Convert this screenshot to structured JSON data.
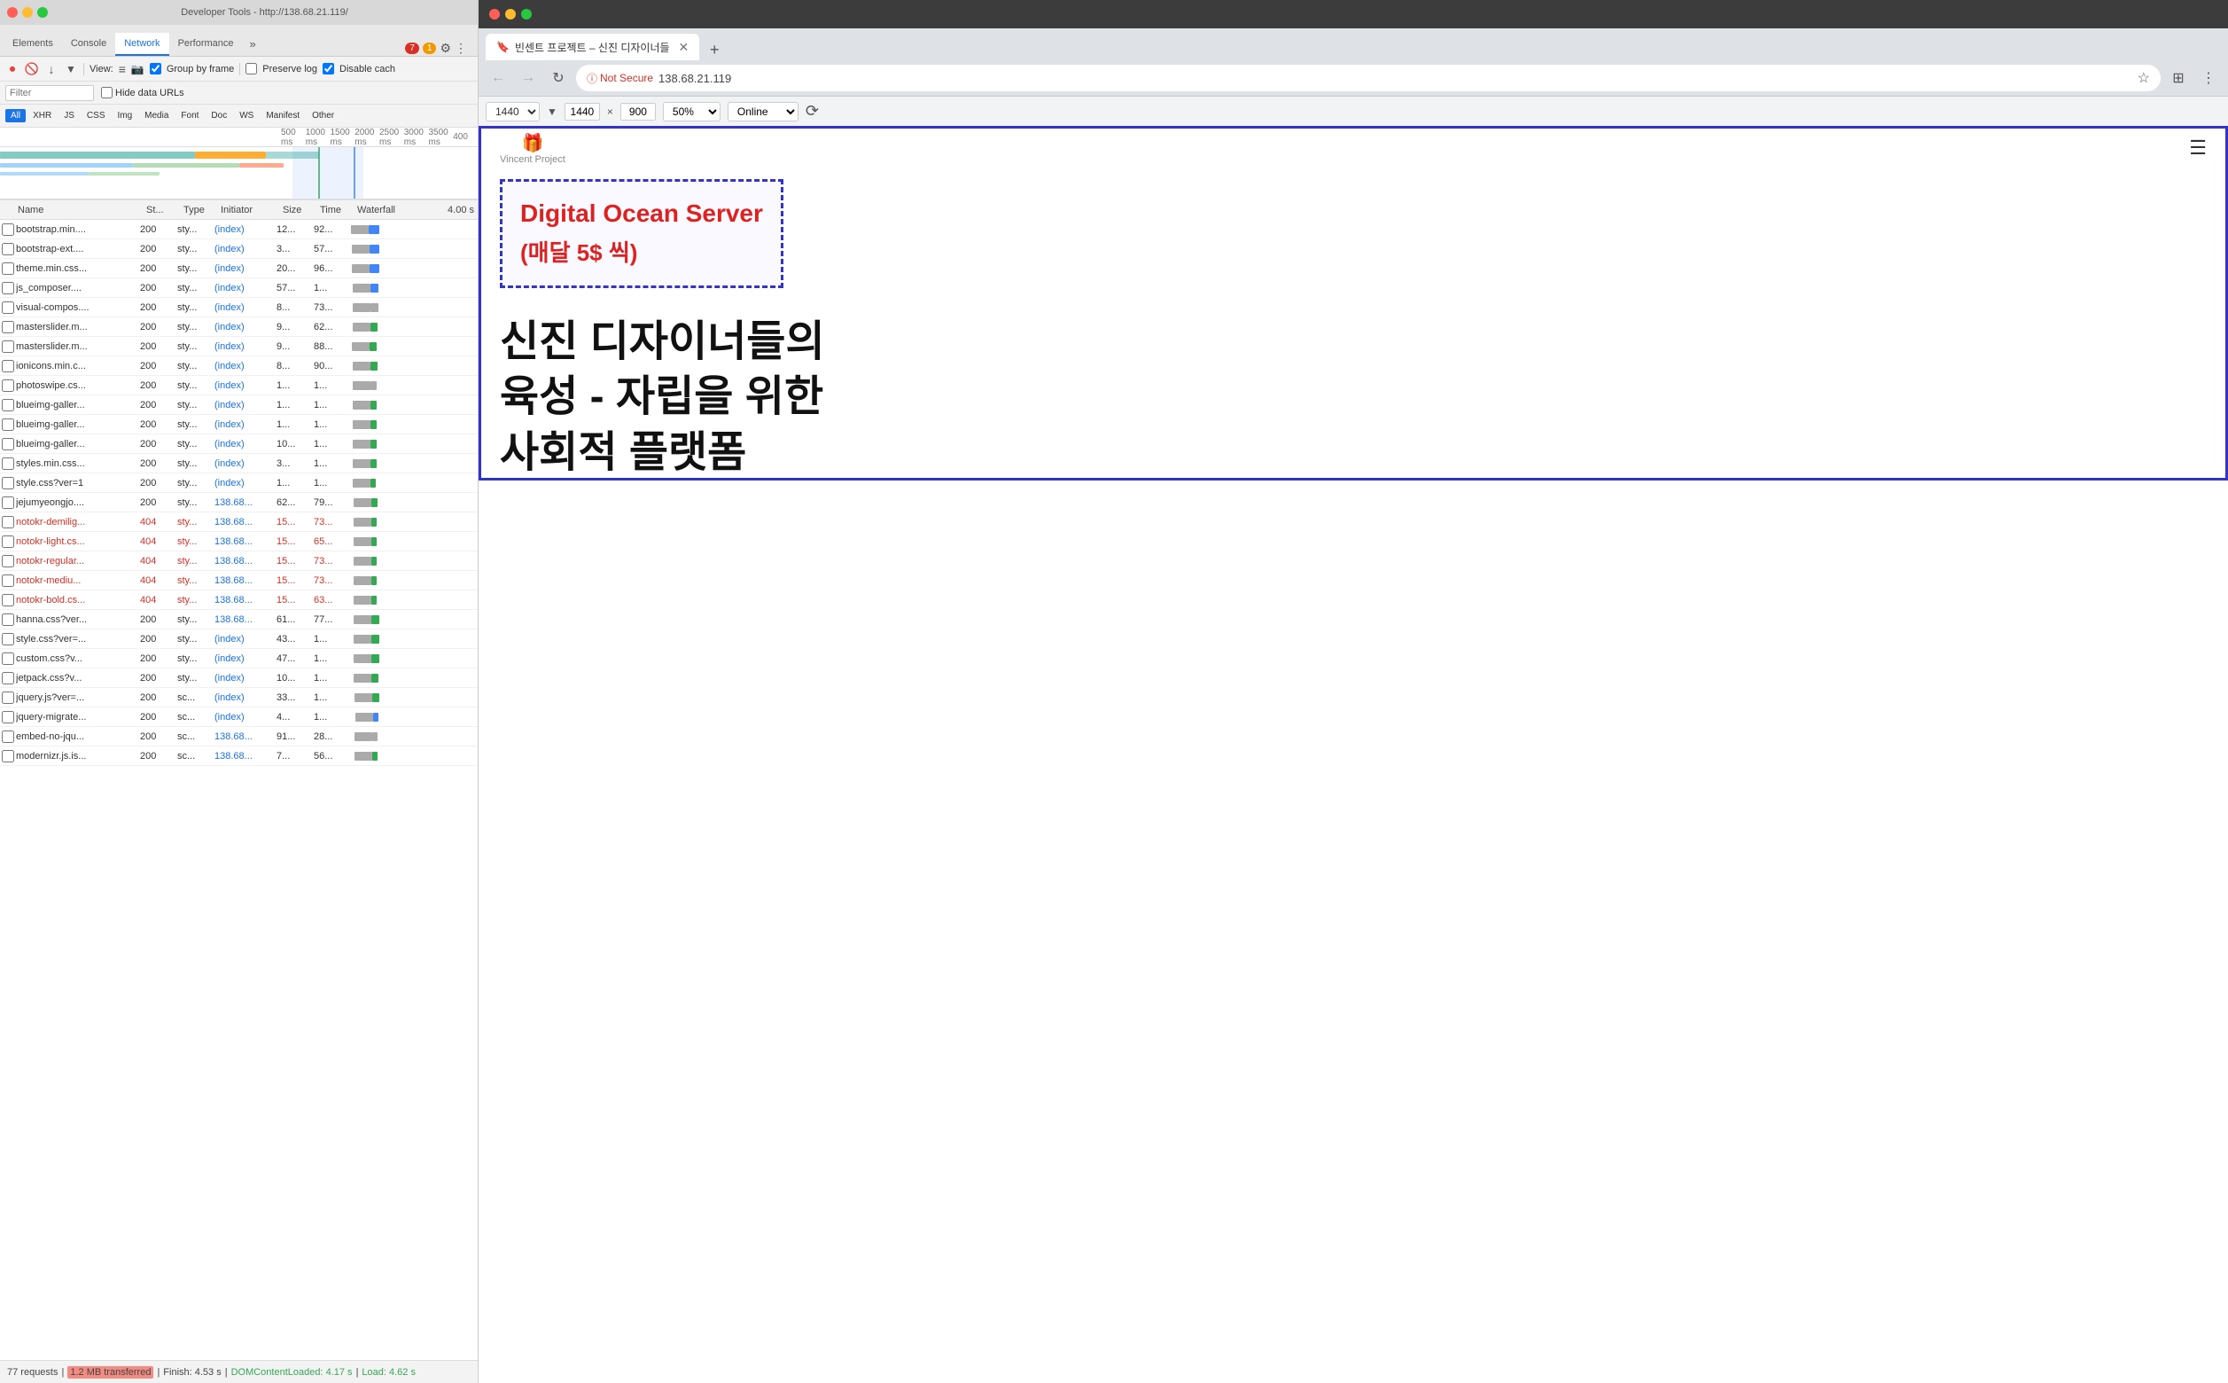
{
  "devtools": {
    "titlebar": "Developer Tools - http://138.68.21.119/",
    "tabs": [
      {
        "label": "Elements",
        "active": false
      },
      {
        "label": "Console",
        "active": false
      },
      {
        "label": "Network",
        "active": true
      },
      {
        "label": "Performance",
        "active": false
      }
    ],
    "tab_more": "»",
    "errors": "7",
    "warnings": "1",
    "toolbar": {
      "record_label": "●",
      "clear_label": "🚫",
      "fetch_label": "↓",
      "filter_label": "▼",
      "view_label": "View:",
      "group_by_frame": "Group by frame",
      "preserve_log": "Preserve log",
      "disable_cache": "Disable cach"
    },
    "filter": {
      "placeholder": "Filter",
      "hide_data_urls": "Hide data URLs"
    },
    "type_filters": [
      "All",
      "XHR",
      "JS",
      "CSS",
      "Img",
      "Media",
      "Font",
      "Doc",
      "WS",
      "Manifest",
      "Other"
    ],
    "active_type": "All",
    "ruler": {
      "marks": [
        "500 ms",
        "1000 ms",
        "1500 ms",
        "2000 ms",
        "2500 ms",
        "3000 ms",
        "3500 ms",
        "400"
      ]
    },
    "table_headers": {
      "name": "Name",
      "status": "St...",
      "type": "Type",
      "initiator": "Initiator",
      "size": "Size",
      "time": "Time",
      "waterfall": "Waterfall",
      "waterfall_right": "4.00 s"
    },
    "rows": [
      {
        "name": "bootstrap.min....",
        "status": "200",
        "type": "sty...",
        "initiator": "(index)",
        "size": "12...",
        "time": "92...",
        "wf_start": 0,
        "wf_len": 60,
        "color": "blue",
        "error": false
      },
      {
        "name": "bootstrap-ext....",
        "status": "200",
        "type": "sty...",
        "initiator": "(index)",
        "size": "3...",
        "time": "57...",
        "wf_start": 5,
        "wf_len": 55,
        "color": "blue",
        "error": false
      },
      {
        "name": "theme.min.css...",
        "status": "200",
        "type": "sty...",
        "initiator": "(index)",
        "size": "20...",
        "time": "96...",
        "wf_start": 3,
        "wf_len": 58,
        "color": "blue",
        "error": false
      },
      {
        "name": "js_composer....",
        "status": "200",
        "type": "sty...",
        "initiator": "(index)",
        "size": "57...",
        "time": "1...",
        "wf_start": 8,
        "wf_len": 50,
        "color": "blue",
        "error": false
      },
      {
        "name": "visual-compos....",
        "status": "200",
        "type": "sty...",
        "initiator": "(index)",
        "size": "8...",
        "time": "73...",
        "wf_start": 10,
        "wf_len": 45,
        "color": "gray",
        "error": false
      },
      {
        "name": "masterslider.m...",
        "status": "200",
        "type": "sty...",
        "initiator": "(index)",
        "size": "9...",
        "time": "62...",
        "wf_start": 8,
        "wf_len": 40,
        "color": "green",
        "error": false
      },
      {
        "name": "masterslider.m...",
        "status": "200",
        "type": "sty...",
        "initiator": "(index)",
        "size": "9...",
        "time": "88...",
        "wf_start": 6,
        "wf_len": 42,
        "color": "green",
        "error": false
      },
      {
        "name": "ionicons.min.c...",
        "status": "200",
        "type": "sty...",
        "initiator": "(index)",
        "size": "8...",
        "time": "90...",
        "wf_start": 7,
        "wf_len": 44,
        "color": "green",
        "error": false
      },
      {
        "name": "photoswipe.cs...",
        "status": "200",
        "type": "sty...",
        "initiator": "(index)",
        "size": "1...",
        "time": "1...",
        "wf_start": 9,
        "wf_len": 38,
        "color": "gray",
        "error": false
      },
      {
        "name": "blueimg-galler...",
        "status": "200",
        "type": "sty...",
        "initiator": "(index)",
        "size": "1...",
        "time": "1...",
        "wf_start": 9,
        "wf_len": 38,
        "color": "green",
        "error": false
      },
      {
        "name": "blueimg-galler...",
        "status": "200",
        "type": "sty...",
        "initiator": "(index)",
        "size": "1...",
        "time": "1...",
        "wf_start": 9,
        "wf_len": 38,
        "color": "green",
        "error": false
      },
      {
        "name": "blueimg-galler...",
        "status": "200",
        "type": "sty...",
        "initiator": "(index)",
        "size": "10...",
        "time": "1...",
        "wf_start": 9,
        "wf_len": 38,
        "color": "green",
        "error": false
      },
      {
        "name": "styles.min.css...",
        "status": "200",
        "type": "sty...",
        "initiator": "(index)",
        "size": "3...",
        "time": "1...",
        "wf_start": 8,
        "wf_len": 36,
        "color": "green",
        "error": false
      },
      {
        "name": "style.css?ver=1",
        "status": "200",
        "type": "sty...",
        "initiator": "(index)",
        "size": "1...",
        "time": "1...",
        "wf_start": 8,
        "wf_len": 34,
        "color": "green",
        "error": false
      },
      {
        "name": "jejumyeongjo....",
        "status": "200",
        "type": "sty...",
        "initiator": "138.68...",
        "size": "62...",
        "time": "79...",
        "wf_start": 12,
        "wf_len": 40,
        "color": "green",
        "error": false
      },
      {
        "name": "notokr-demilig...",
        "status": "404",
        "type": "sty...",
        "initiator": "138.68...",
        "size": "15...",
        "time": "73...",
        "wf_start": 11,
        "wf_len": 30,
        "color": "green",
        "error": true
      },
      {
        "name": "notokr-light.cs...",
        "status": "404",
        "type": "sty...",
        "initiator": "138.68...",
        "size": "15...",
        "time": "65...",
        "wf_start": 11,
        "wf_len": 28,
        "color": "green",
        "error": true
      },
      {
        "name": "notokr-regular...",
        "status": "404",
        "type": "sty...",
        "initiator": "138.68...",
        "size": "15...",
        "time": "73...",
        "wf_start": 11,
        "wf_len": 30,
        "color": "green",
        "error": true
      },
      {
        "name": "notokr-mediu...",
        "status": "404",
        "type": "sty...",
        "initiator": "138.68...",
        "size": "15...",
        "time": "73...",
        "wf_start": 11,
        "wf_len": 30,
        "color": "green",
        "error": true
      },
      {
        "name": "notokr-bold.cs...",
        "status": "404",
        "type": "sty...",
        "initiator": "138.68...",
        "size": "15...",
        "time": "63...",
        "wf_start": 11,
        "wf_len": 28,
        "color": "green",
        "error": true
      },
      {
        "name": "hanna.css?ver...",
        "status": "200",
        "type": "sty...",
        "initiator": "138.68...",
        "size": "61...",
        "time": "77...",
        "wf_start": 15,
        "wf_len": 45,
        "color": "green",
        "error": false
      },
      {
        "name": "style.css?ver=...",
        "status": "200",
        "type": "sty...",
        "initiator": "(index)",
        "size": "43...",
        "time": "1...",
        "wf_start": 14,
        "wf_len": 44,
        "color": "green",
        "error": false
      },
      {
        "name": "custom.css?v...",
        "status": "200",
        "type": "sty...",
        "initiator": "(index)",
        "size": "47...",
        "time": "1...",
        "wf_start": 14,
        "wf_len": 44,
        "color": "green",
        "error": false
      },
      {
        "name": "jetpack.css?v...",
        "status": "200",
        "type": "sty...",
        "initiator": "(index)",
        "size": "10...",
        "time": "1...",
        "wf_start": 14,
        "wf_len": 42,
        "color": "green",
        "error": false
      },
      {
        "name": "jquery.js?ver=...",
        "status": "200",
        "type": "sc...",
        "initiator": "(index)",
        "size": "33...",
        "time": "1...",
        "wf_start": 16,
        "wf_len": 46,
        "color": "green",
        "error": false
      },
      {
        "name": "jquery-migrate...",
        "status": "200",
        "type": "sc...",
        "initiator": "(index)",
        "size": "4...",
        "time": "1...",
        "wf_start": 20,
        "wf_len": 30,
        "color": "blue",
        "error": false
      },
      {
        "name": "embed-no-jqu...",
        "status": "200",
        "type": "sc...",
        "initiator": "138.68...",
        "size": "91...",
        "time": "28...",
        "wf_start": 18,
        "wf_len": 30,
        "color": "gray",
        "error": false
      },
      {
        "name": "modernizr.js.is...",
        "status": "200",
        "type": "sc...",
        "initiator": "138.68...",
        "size": "7...",
        "time": "56...",
        "wf_start": 18,
        "wf_len": 28,
        "color": "green",
        "error": false
      }
    ],
    "statusbar": {
      "requests": "77 requests",
      "transferred": "1.2 MB transferred",
      "finish": "Finish: 4.53 s",
      "dom_loaded": "DOMContentLoaded: 4.17 s",
      "load": "Load: 4.62 s"
    }
  },
  "browser": {
    "tab_title": "빈센트 프로젝트 – 신진 디자이너들",
    "tab_favicon": "🔒",
    "address_bar": {
      "not_secure": "Not Secure",
      "url": "138.68.21.119"
    },
    "viewport": {
      "preset": "1440",
      "width": "1440",
      "height": "900",
      "scale": "50%",
      "network": "Online"
    },
    "page": {
      "logo_icon": "🎁",
      "logo_text": "Vincent Project",
      "nav_menu": "☰",
      "dashed_box": {
        "title": "Digital Ocean Server",
        "subtitle": "(매달 5$ 씩)"
      },
      "main_text": "신진 디자이너들의\n육성 - 자립을 위한\n사회적 플랫폼"
    }
  }
}
